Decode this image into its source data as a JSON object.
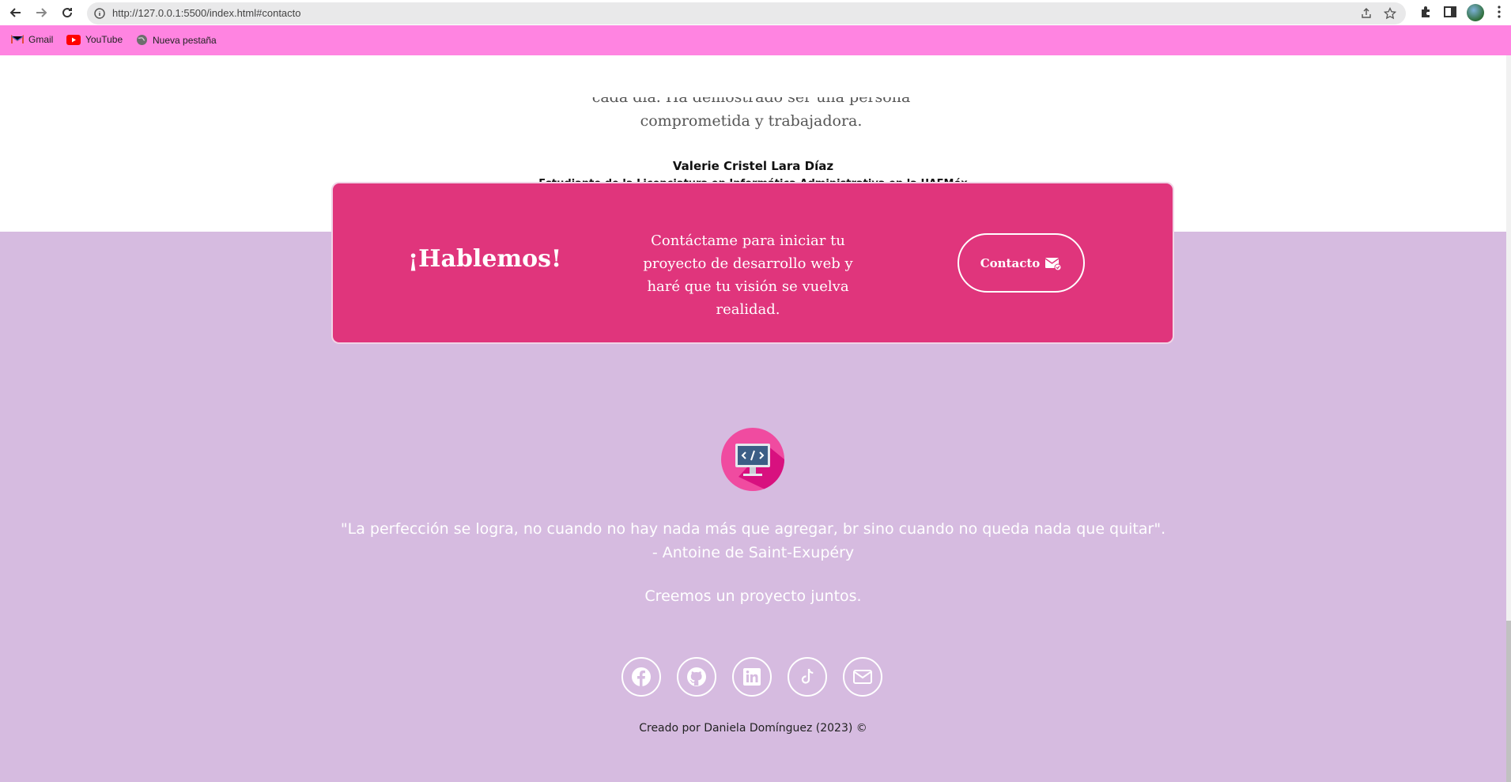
{
  "browser": {
    "url": "http://127.0.0.1:5500/index.html#contacto",
    "bookmarks": [
      {
        "label": "Gmail",
        "icon": "gmail-icon"
      },
      {
        "label": "YouTube",
        "icon": "youtube-icon"
      },
      {
        "label": "Nueva pestaña",
        "icon": "globe-icon"
      }
    ]
  },
  "testimonial": {
    "text_lines": [
      "cada día. Ha demostrado ser una persona responsable,",
      "comprometida y trabajadora."
    ],
    "name": "Valerie Cristel Lara Díaz",
    "role": "Estudiante de la Licenciatura en Informática Administrativa en la UAEMéx"
  },
  "cta": {
    "title": "¡Hablemos!",
    "text": "Contáctame para iniciar tu proyecto de desarrollo web y haré que tu visión se vuelva realidad.",
    "button_label": "Contacto"
  },
  "footer": {
    "quote_line1": "\"La perfección se logra, no cuando no hay nada más que agregar, br sino cuando no queda nada que quitar\".",
    "quote_line2": "- Antoine de Saint-Exupéry",
    "tagline": "Creemos un proyecto juntos.",
    "socials": [
      "facebook-icon",
      "github-icon",
      "linkedin-icon",
      "tiktok-icon",
      "mail-icon"
    ],
    "credit": "Creado por Daniela Domínguez (2023) ©"
  },
  "colors": {
    "bookmark_bar": "#ff84e1",
    "cta_background": "#e0357c",
    "footer_background": "#d6bbe0"
  }
}
